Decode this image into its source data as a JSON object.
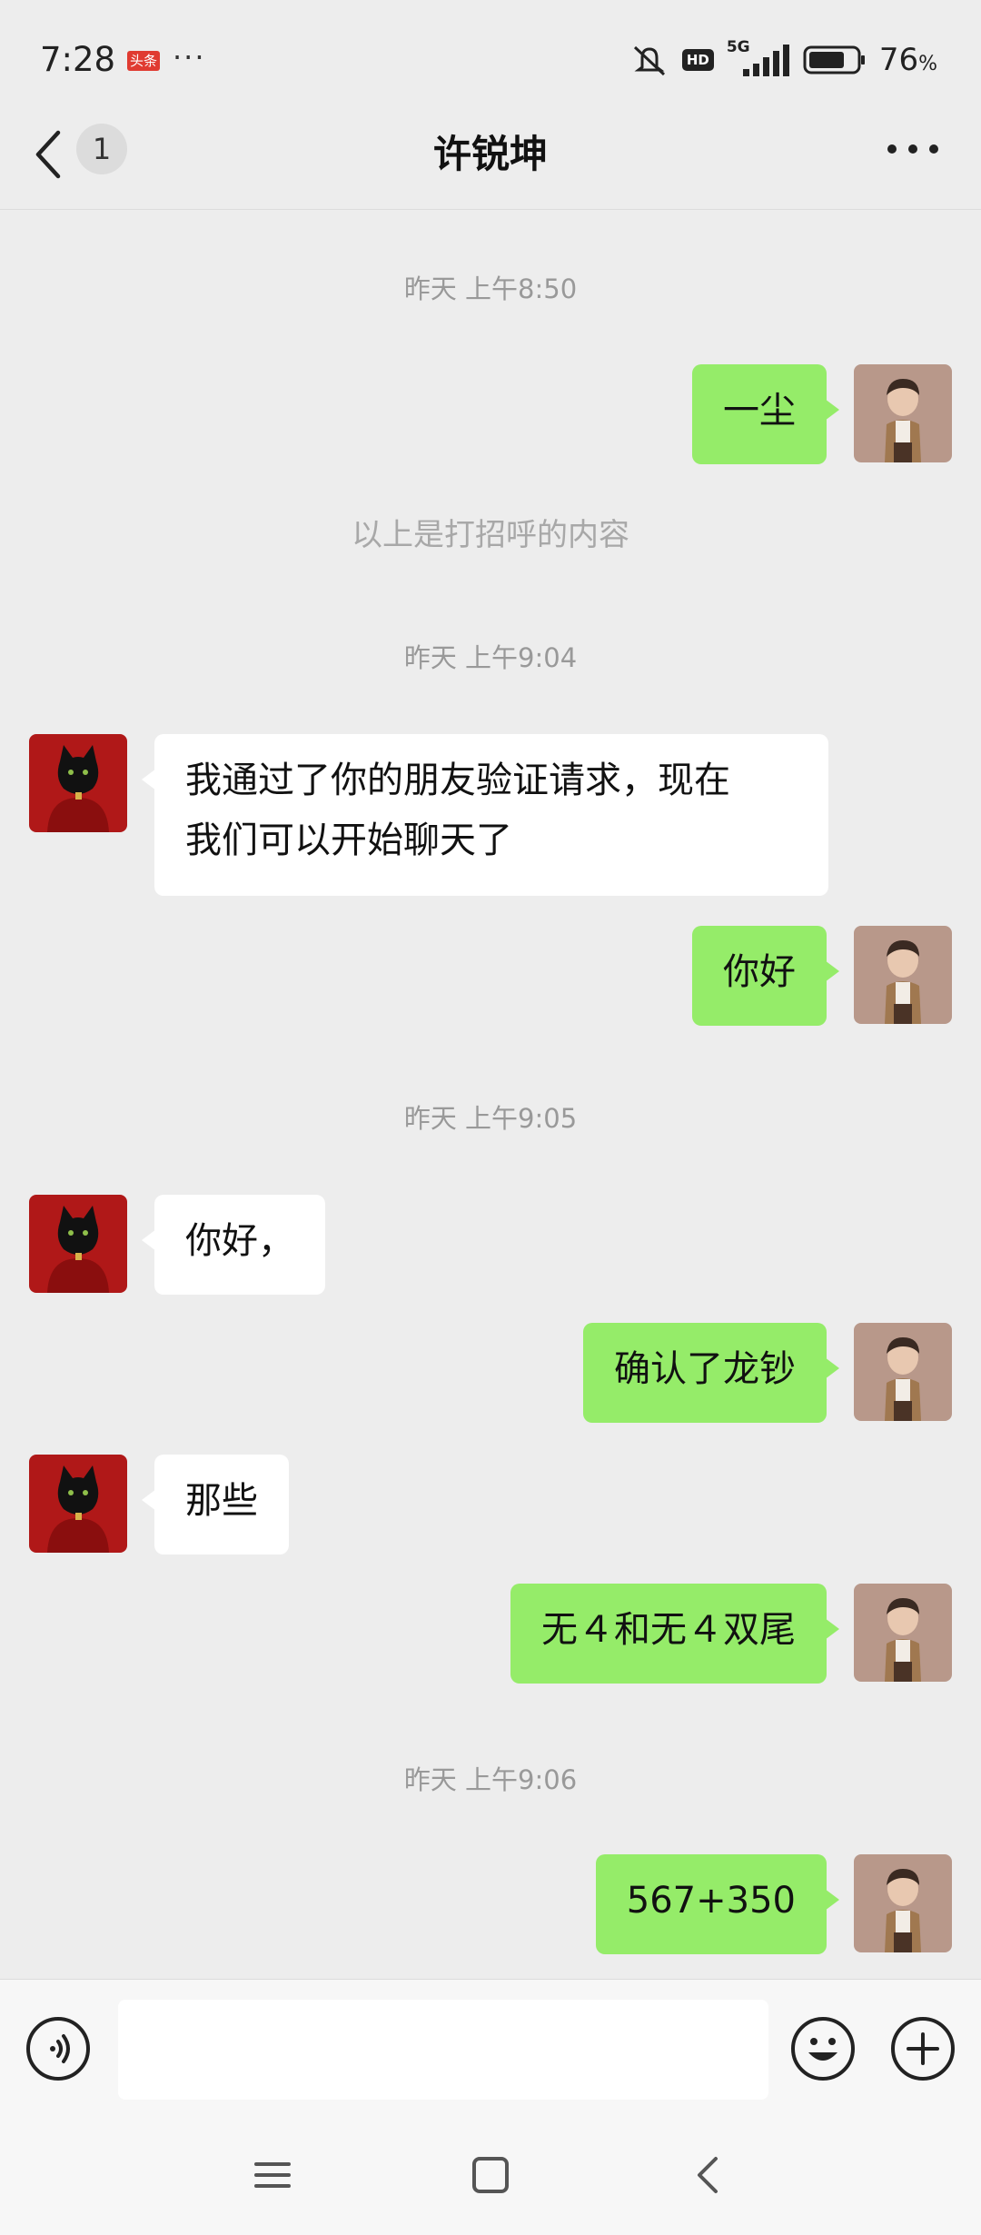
{
  "status_bar": {
    "time": "7:28",
    "badge": "头条",
    "dots": "···",
    "hd_label": "HD",
    "network": "5G",
    "battery_pct": "76",
    "battery_unit": "%",
    "battery_level": 0.76
  },
  "header": {
    "unread_count": "1",
    "title": "许锐坤"
  },
  "messages": {
    "ts1": "昨天 上午8:50",
    "m1": "一尘",
    "sys1": "以上是打招呼的内容",
    "ts2": "昨天 上午9:04",
    "m2_line1": "我通过了你的朋友验证请求，现在",
    "m2_line2": "我们可以开始聊天了",
    "m3": "你好",
    "ts3": "昨天 上午9:05",
    "m4": "你好，",
    "m5": "确认了龙钞",
    "m6": "那些",
    "m7": "无４和无４双尾",
    "ts4": "昨天 上午9:06",
    "m8": "567+350"
  },
  "input": {
    "placeholder": ""
  },
  "colors": {
    "background": "#ededed",
    "my_bubble": "#95ec69",
    "other_bubble": "#ffffff",
    "avatar_red": "#b01818"
  },
  "icons": {
    "voice": "voice-icon",
    "emoji": "emoji-icon",
    "plus": "plus-icon",
    "menu": "menu-icon",
    "home": "home-icon",
    "back": "back-nav-icon"
  }
}
